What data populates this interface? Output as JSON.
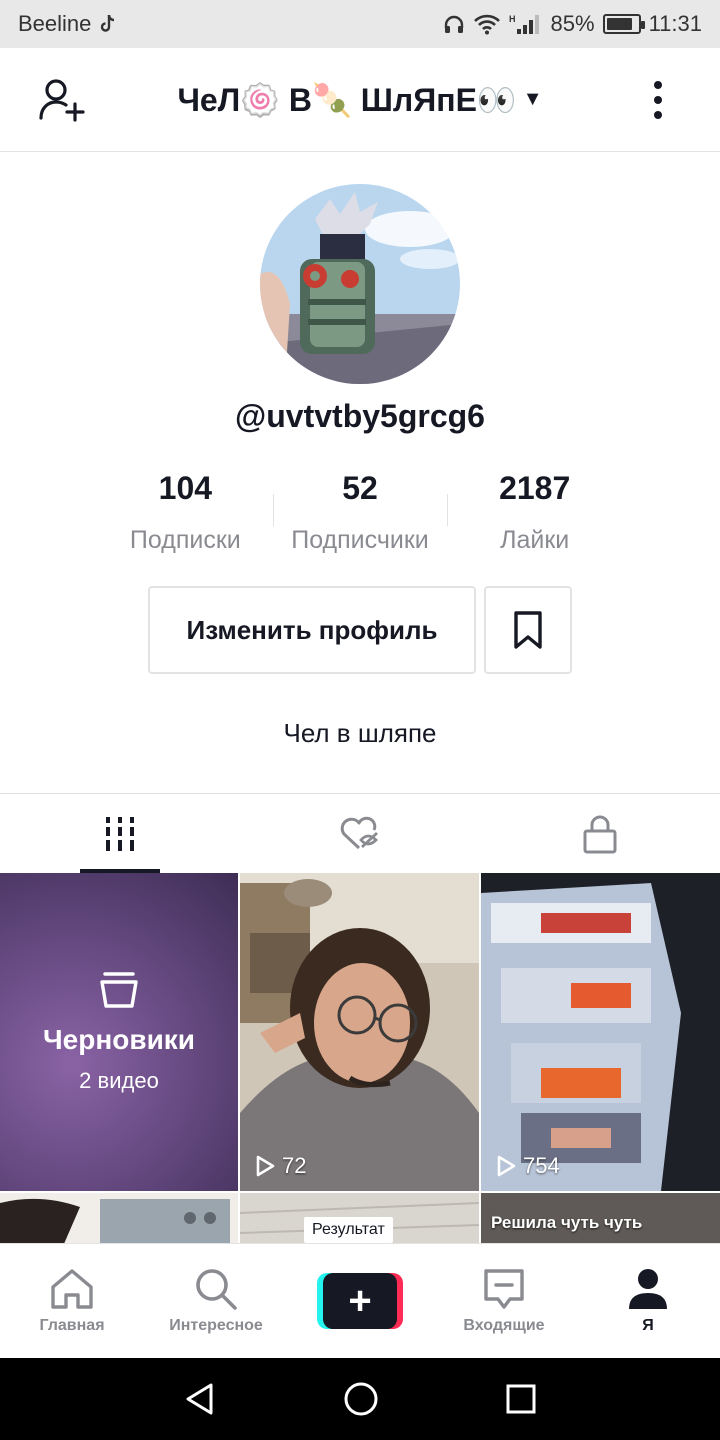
{
  "status_bar": {
    "carrier": "Beeline",
    "battery": "85%",
    "battery_level": 0.85,
    "time": "11:31"
  },
  "header": {
    "title": "ЧеЛ🍥 В🍡 ШлЯпЕ👀"
  },
  "profile": {
    "username": "@uvtvtby5grcg6",
    "stats": [
      {
        "value": "104",
        "label": "Подписки"
      },
      {
        "value": "52",
        "label": "Подписчики"
      },
      {
        "value": "2187",
        "label": "Лайки"
      }
    ],
    "edit_label": "Изменить профиль",
    "bio": "Чел в шляпе"
  },
  "tabs": [
    {
      "icon": "videos-grid-icon",
      "active": true
    },
    {
      "icon": "liked-hidden-icon",
      "active": false
    },
    {
      "icon": "lock-icon",
      "active": false
    }
  ],
  "grid": {
    "drafts": {
      "title": "Черновики",
      "subtitle": "2 видео"
    },
    "videos": [
      {
        "views": "72"
      },
      {
        "views": "754"
      }
    ],
    "row2": {
      "label": "Результат",
      "caption": "Решила чуть чуть"
    }
  },
  "bottom_nav": [
    {
      "label": "Главная",
      "icon": "home-icon"
    },
    {
      "label": "Интересное",
      "icon": "search-icon"
    },
    {
      "label": "",
      "icon": "create-icon"
    },
    {
      "label": "Входящие",
      "icon": "inbox-icon"
    },
    {
      "label": "Я",
      "icon": "profile-icon",
      "active": true
    }
  ]
}
